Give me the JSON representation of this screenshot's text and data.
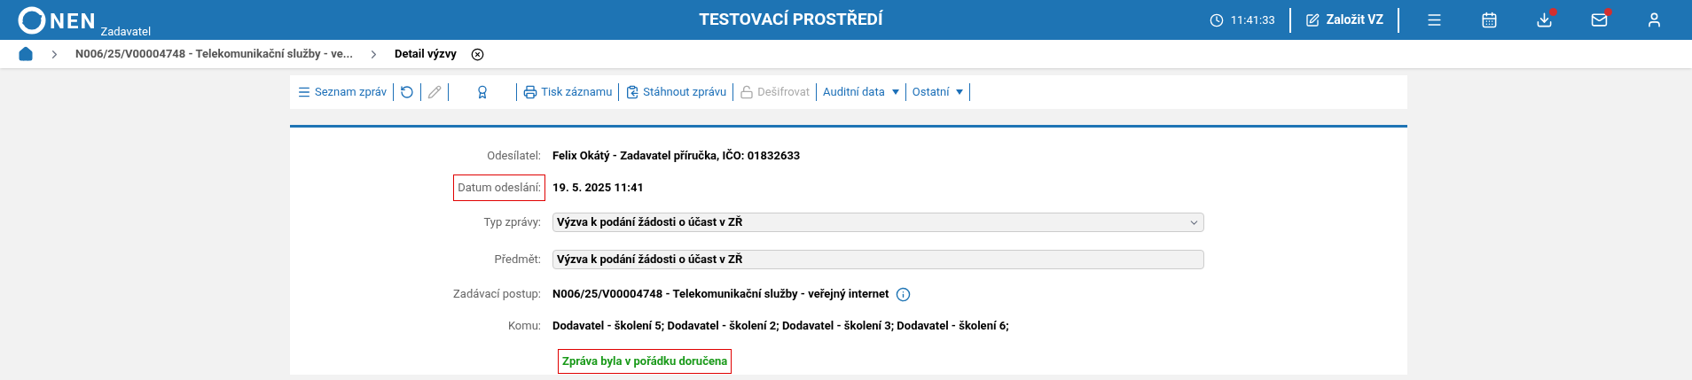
{
  "header": {
    "logo": "NEN",
    "role": "Zadavatel",
    "title": "TESTOVACÍ PROSTŘEDÍ",
    "time": "11:41:33",
    "create_button": "Založit VZ",
    "icons": [
      {
        "kind": "menu",
        "badge": false
      },
      {
        "kind": "calendar",
        "badge": false
      },
      {
        "kind": "download",
        "badge": true
      },
      {
        "kind": "mail",
        "badge": true
      },
      {
        "kind": "user",
        "badge": false
      }
    ]
  },
  "breadcrumb": [
    {
      "label": "N006/25/V00004748 - Telekomunikační služby - ve...",
      "current": false
    },
    {
      "label": "Detail výzvy",
      "current": true
    }
  ],
  "toolbar": [
    {
      "kind": "menu",
      "label": "Seznam zpráv",
      "disabled": false
    },
    {
      "kind": "refresh",
      "disabled": false
    },
    {
      "kind": "edit",
      "disabled": true
    },
    {
      "kind": "award",
      "disabled": false
    },
    {
      "kind": "print",
      "label": "Tisk záznamu",
      "disabled": false
    },
    {
      "kind": "download",
      "label": "Stáhnout zprávu",
      "disabled": false
    },
    {
      "kind": "unlock",
      "label": "Dešifrovat",
      "disabled": true
    },
    {
      "kind": "dropdown",
      "label": "Auditní data",
      "disabled": false
    },
    {
      "kind": "dropdown",
      "label": "Ostatní",
      "disabled": false
    }
  ],
  "fields": [
    {
      "kind": "text",
      "label": "Odesílatel:",
      "value": "Felix Okátý - Zadavatel příručka, IČO: 01832633",
      "highlighted": false
    },
    {
      "kind": "text",
      "label": "Datum odeslání:",
      "value": "19. 5. 2025 11:41",
      "highlighted": true
    },
    {
      "kind": "select",
      "label": "Typ zprávy:",
      "value": "Výzva k podání žádosti o účast v ZŘ",
      "highlighted": false
    },
    {
      "kind": "input",
      "label": "Předmět:",
      "value": "Výzva k podání žádosti o účast v ZŘ",
      "highlighted": false
    },
    {
      "kind": "info",
      "label": "Zadávací postup:",
      "value": "N006/25/V00004748 - Telekomunikační služby - veřejný internet",
      "highlighted": false
    },
    {
      "kind": "text",
      "label": "Komu:",
      "value": "Dodavatel - školení 5; Dodavatel - školení 2; Dodavatel - školení 3; Dodavatel - školení 6;",
      "highlighted": false
    }
  ],
  "status": {
    "text": "Zpráva byla v pořádku doručena",
    "highlighted": true
  }
}
